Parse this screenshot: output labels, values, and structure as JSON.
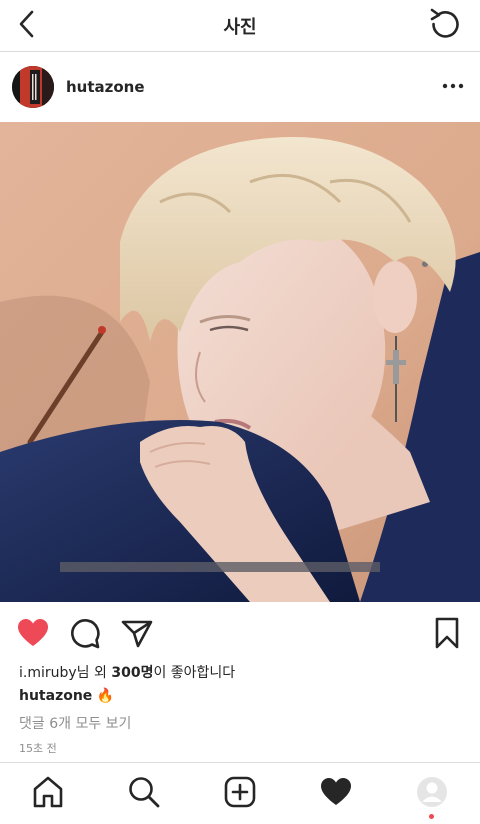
{
  "header": {
    "title": "사진",
    "back_icon": "chevron-left-icon",
    "refresh_icon": "refresh-icon"
  },
  "post": {
    "username": "hutazone",
    "avatar_label": "hutazone profile picture",
    "likes": {
      "user": "i.miruby",
      "mid_text": "님 외 ",
      "count": "300명",
      "suffix": "이 좋아합니다"
    },
    "caption": {
      "username": "hutazone",
      "text": " 🔥"
    },
    "comments_link": "댓글 6개 모두 보기",
    "timestamp": "15초 전",
    "liked": true
  },
  "colors": {
    "like_red": "#ed4956",
    "text": "#262626",
    "muted": "#8e8e8e",
    "divider": "#dbdbdb"
  },
  "tabbar": {
    "items": [
      "home-icon",
      "search-icon",
      "new-post-icon",
      "activity-heart-icon",
      "profile-icon"
    ],
    "notification_dot": true
  }
}
